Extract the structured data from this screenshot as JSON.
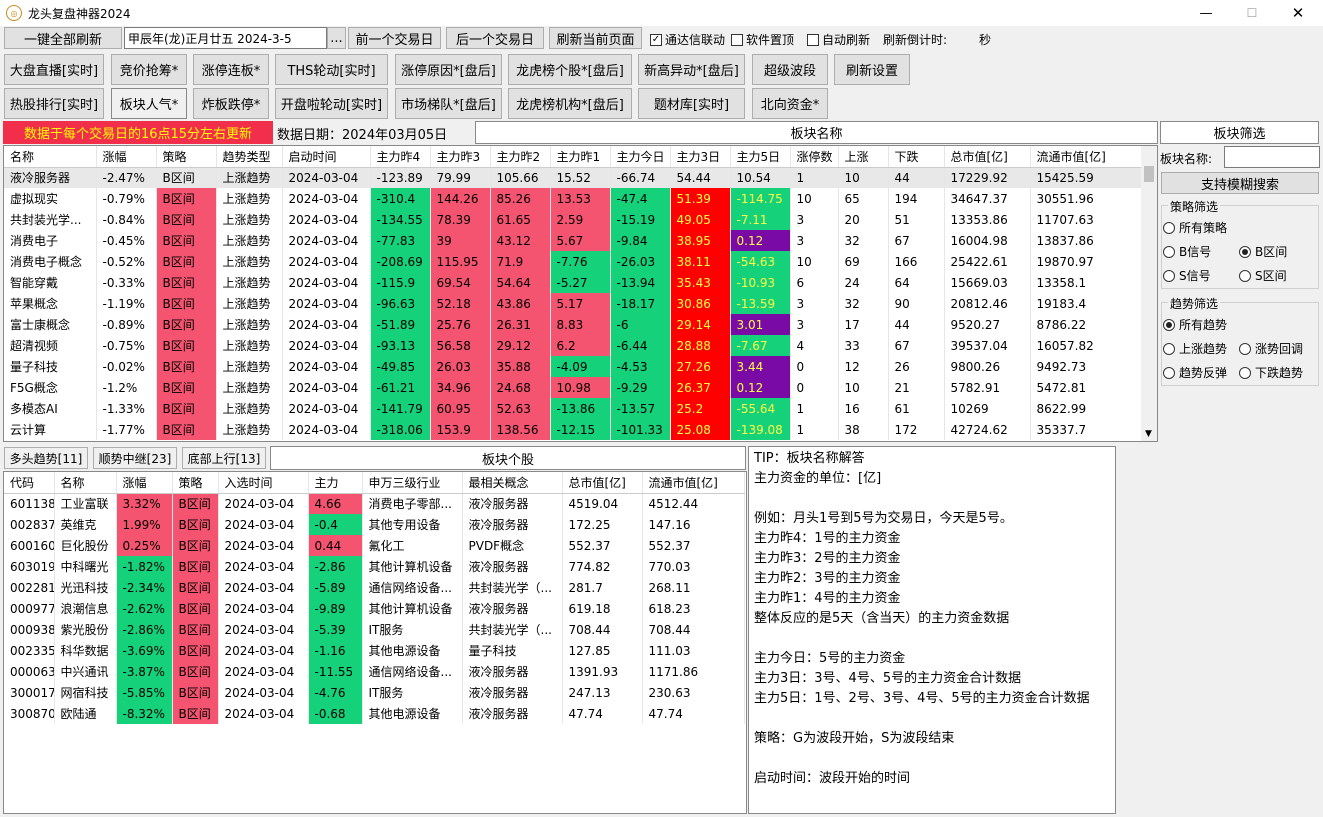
{
  "window": {
    "title": "龙头复盘神器2024",
    "icon": "app-logo-icon",
    "minimize": "—",
    "maximize": "☐",
    "close": "✕"
  },
  "toolbar": {
    "refresh_all": "一键全部刷新",
    "date_value": "甲辰年(龙)正月廿五  2024-3-5",
    "date_picker": "...",
    "prev_day": "前一个交易日",
    "next_day": "后一个交易日",
    "refresh_page": "刷新当前页面",
    "tdx_link": "通达信联动",
    "tdx_link_checked": true,
    "pin_top": "软件置顶",
    "pin_top_checked": false,
    "auto_refresh": "自动刷新",
    "auto_refresh_checked": false,
    "countdown_label": "刷新倒计时:",
    "countdown_unit": "秒"
  },
  "nav_row1": [
    "大盘直播[实时]",
    "竞价抢筹*",
    "涨停连板*",
    "THS轮动[实时]",
    "涨停原因*[盘后]",
    "龙虎榜个股*[盘后]",
    "新高异动*[盘后]",
    "超级波段",
    "刷新设置"
  ],
  "nav_row2": [
    "热股排行[实时]",
    "板块人气*",
    "炸板跌停*",
    "开盘啦轮动[实时]",
    "市场梯队*[盘后]",
    "龙虎榜机构*[盘后]",
    "题材库[实时]",
    "北向资金*"
  ],
  "status": {
    "notice": "数据于每个交易日的16点15分左右更新",
    "data_date": "数据日期：2024年03月05日",
    "sector_header": "板块名称",
    "filter_header": "板块筛选"
  },
  "sector_table": {
    "headers": [
      "名称",
      "涨幅",
      "策略",
      "趋势类型",
      "启动时间",
      "主力昨4",
      "主力昨3",
      "主力昨2",
      "主力昨1",
      "主力今日",
      "主力3日",
      "主力5日",
      "涨停数",
      "上涨",
      "下跌",
      "总市值[亿]",
      "流通市值[亿]"
    ],
    "rows": [
      [
        "液冷服务器",
        "-2.47%",
        "B区间",
        "上涨趋势",
        "2024-03-04",
        "-123.89",
        "79.99",
        "105.66",
        "15.52",
        "-66.74",
        "54.44",
        "10.54",
        "1",
        "10",
        "44",
        "17229.92",
        "15425.59"
      ],
      [
        "虚拟现实",
        "-0.79%",
        "B区间",
        "上涨趋势",
        "2024-03-04",
        "-310.4",
        "144.26",
        "85.26",
        "13.53",
        "-47.4",
        "51.39",
        "-114.75",
        "10",
        "65",
        "194",
        "34647.37",
        "30551.96"
      ],
      [
        "共封装光学...",
        "-0.84%",
        "B区间",
        "上涨趋势",
        "2024-03-04",
        "-134.55",
        "78.39",
        "61.65",
        "2.59",
        "-15.19",
        "49.05",
        "-7.11",
        "3",
        "20",
        "51",
        "13353.86",
        "11707.63"
      ],
      [
        "消费电子",
        "-0.45%",
        "B区间",
        "上涨趋势",
        "2024-03-04",
        "-77.83",
        "39",
        "43.12",
        "5.67",
        "-9.84",
        "38.95",
        "0.12",
        "3",
        "32",
        "67",
        "16004.98",
        "13837.86"
      ],
      [
        "消费电子概念",
        "-0.52%",
        "B区间",
        "上涨趋势",
        "2024-03-04",
        "-208.69",
        "115.95",
        "71.9",
        "-7.76",
        "-26.03",
        "38.11",
        "-54.63",
        "10",
        "69",
        "166",
        "25422.61",
        "19870.97"
      ],
      [
        "智能穿戴",
        "-0.33%",
        "B区间",
        "上涨趋势",
        "2024-03-04",
        "-115.9",
        "69.54",
        "54.64",
        "-5.27",
        "-13.94",
        "35.43",
        "-10.93",
        "6",
        "24",
        "64",
        "15669.03",
        "13358.1"
      ],
      [
        "苹果概念",
        "-1.19%",
        "B区间",
        "上涨趋势",
        "2024-03-04",
        "-96.63",
        "52.18",
        "43.86",
        "5.17",
        "-18.17",
        "30.86",
        "-13.59",
        "3",
        "32",
        "90",
        "20812.46",
        "19183.4"
      ],
      [
        "富士康概念",
        "-0.89%",
        "B区间",
        "上涨趋势",
        "2024-03-04",
        "-51.89",
        "25.76",
        "26.31",
        "8.83",
        "-6",
        "29.14",
        "3.01",
        "3",
        "17",
        "44",
        "9520.27",
        "8786.22"
      ],
      [
        "超清视频",
        "-0.75%",
        "B区间",
        "上涨趋势",
        "2024-03-04",
        "-93.13",
        "56.58",
        "29.12",
        "6.2",
        "-6.44",
        "28.88",
        "-7.67",
        "4",
        "33",
        "67",
        "39537.04",
        "16057.82"
      ],
      [
        "量子科技",
        "-0.02%",
        "B区间",
        "上涨趋势",
        "2024-03-04",
        "-49.85",
        "26.03",
        "35.88",
        "-4.09",
        "-4.53",
        "27.26",
        "3.44",
        "0",
        "12",
        "26",
        "9800.26",
        "9492.73"
      ],
      [
        "F5G概念",
        "-1.2%",
        "B区间",
        "上涨趋势",
        "2024-03-04",
        "-61.21",
        "34.96",
        "24.68",
        "10.98",
        "-9.29",
        "26.37",
        "0.12",
        "0",
        "10",
        "21",
        "5782.91",
        "5472.81"
      ],
      [
        "多模态AI",
        "-1.33%",
        "B区间",
        "上涨趋势",
        "2024-03-04",
        "-141.79",
        "60.95",
        "52.63",
        "-13.86",
        "-13.57",
        "25.2",
        "-55.64",
        "1",
        "16",
        "61",
        "10269",
        "8622.99"
      ],
      [
        "云计算",
        "-1.77%",
        "B区间",
        "上涨趋势",
        "2024-03-04",
        "-318.06",
        "153.9",
        "138.56",
        "-12.15",
        "-101.33",
        "25.08",
        "-139.08",
        "1",
        "38",
        "172",
        "42724.62",
        "35337.7"
      ]
    ]
  },
  "filter": {
    "name_label": "板块名称:",
    "name_value": "",
    "fuzzy_search": "支持模糊搜索",
    "strategy_title": "策略筛选",
    "strategy_options": [
      "所有策略",
      "B信号",
      "B区间",
      "S信号",
      "S区间"
    ],
    "strategy_selected": "B区间",
    "trend_title": "趋势筛选",
    "trend_options": [
      "所有趋势",
      "上涨趋势",
      "涨势回调",
      "趋势反弹",
      "下跌趋势"
    ],
    "trend_selected": "所有趋势"
  },
  "tabs": [
    "多头趋势[11]",
    "顺势中继[23]",
    "底部上行[13]"
  ],
  "stock_header": "板块个股",
  "stock_table": {
    "headers": [
      "代码",
      "名称",
      "涨幅",
      "策略",
      "入选时间",
      "主力",
      "申万三级行业",
      "最相关概念",
      "总市值[亿]",
      "流通市值[亿]"
    ],
    "rows": [
      [
        "601138",
        "工业富联",
        "3.32%",
        "B区间",
        "2024-03-04",
        "4.66",
        "消费电子零部...",
        "液冷服务器",
        "4519.04",
        "4512.44"
      ],
      [
        "002837",
        "英维克",
        "1.99%",
        "B区间",
        "2024-03-04",
        "-0.4",
        "其他专用设备",
        "液冷服务器",
        "172.25",
        "147.16"
      ],
      [
        "600160",
        "巨化股份",
        "0.25%",
        "B区间",
        "2024-03-04",
        "0.44",
        "氟化工",
        "PVDF概念",
        "552.37",
        "552.37"
      ],
      [
        "603019",
        "中科曙光",
        "-1.82%",
        "B区间",
        "2024-03-04",
        "-2.86",
        "其他计算机设备",
        "液冷服务器",
        "774.82",
        "770.03"
      ],
      [
        "002281",
        "光迅科技",
        "-2.34%",
        "B区间",
        "2024-03-04",
        "-5.89",
        "通信网络设备...",
        "共封装光学（...",
        "281.7",
        "268.11"
      ],
      [
        "000977",
        "浪潮信息",
        "-2.62%",
        "B区间",
        "2024-03-04",
        "-9.89",
        "其他计算机设备",
        "液冷服务器",
        "619.18",
        "618.23"
      ],
      [
        "000938",
        "紫光股份",
        "-2.86%",
        "B区间",
        "2024-03-04",
        "-5.39",
        "IT服务",
        "共封装光学（...",
        "708.44",
        "708.44"
      ],
      [
        "002335",
        "科华数据",
        "-3.69%",
        "B区间",
        "2024-03-04",
        "-1.16",
        "其他电源设备",
        "量子科技",
        "127.85",
        "111.03"
      ],
      [
        "000063",
        "中兴通讯",
        "-3.87%",
        "B区间",
        "2024-03-04",
        "-11.55",
        "通信网络设备...",
        "液冷服务器",
        "1391.93",
        "1171.86"
      ],
      [
        "300017",
        "网宿科技",
        "-5.85%",
        "B区间",
        "2024-03-04",
        "-4.76",
        "IT服务",
        "液冷服务器",
        "247.13",
        "230.63"
      ],
      [
        "300870",
        "欧陆通",
        "-8.32%",
        "B区间",
        "2024-03-04",
        "-0.68",
        "其他电源设备",
        "液冷服务器",
        "47.74",
        "47.74"
      ]
    ]
  },
  "tip_lines": [
    "TIP：板块名称解答",
    "主力资金的单位：[亿]",
    "",
    "例如：月头1号到5号为交易日，今天是5号。",
    "主力昨4：1号的主力资金",
    "主力昨3：2号的主力资金",
    "主力昨2：3号的主力资金",
    "主力昨1：4号的主力资金",
    "整体反应的是5天（含当天）的主力资金数据",
    "",
    "主力今日：5号的主力资金",
    "主力3日：3号、4号、5号的主力资金合计数据",
    "主力5日：1号、2号、3号、4号、5号的主力资金合计数据",
    "",
    "策略：G为波段开始，S为波段结束",
    "",
    "启动时间：波段开始的时间"
  ],
  "colors": {
    "positive": "#f4546f",
    "negative": "#14d17a",
    "strong_positive": "#ff0000",
    "purple": "#7a0aa6",
    "notice_bg": "#f22f4b",
    "notice_text": "#ffff00"
  }
}
